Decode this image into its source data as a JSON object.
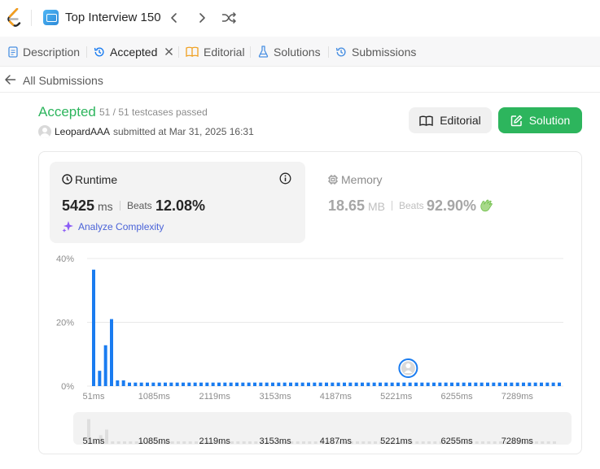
{
  "topbar": {
    "study_title": "Top Interview 150",
    "icons": [
      "leetcode-logo",
      "study-plan-icon",
      "chevron-left-icon",
      "chevron-right-icon",
      "shuffle-icon"
    ]
  },
  "tabs": [
    {
      "label": "Description",
      "icon": "description-icon"
    },
    {
      "label": "Accepted",
      "icon": "history-icon"
    },
    {
      "label": "Editorial",
      "icon": "book-icon"
    },
    {
      "label": "Solutions",
      "icon": "flask-icon"
    },
    {
      "label": "Submissions",
      "icon": "history-icon"
    }
  ],
  "back": {
    "label": "All Submissions"
  },
  "result": {
    "status": "Accepted",
    "testcases": "51 / 51 testcases passed",
    "username": "LeopardAAA",
    "submitted": "submitted at Mar 31, 2025 16:31"
  },
  "buttons": {
    "editorial": "Editorial",
    "solution": "Solution"
  },
  "runtime": {
    "title": "Runtime",
    "value": "5425",
    "unit": "ms",
    "beats_label": "Beats",
    "beats": "12.08%",
    "analyze": "Analyze Complexity"
  },
  "memory": {
    "title": "Memory",
    "value": "18.65",
    "unit": "MB",
    "beats_label": "Beats",
    "beats": "92.90%"
  },
  "colors": {
    "accent_green": "#2db55d",
    "bar_blue": "#1a7cf0",
    "link_purple": "#4a63d8"
  },
  "chart_data": {
    "type": "bar",
    "xlabel": "",
    "ylabel": "",
    "yticks": [
      "0%",
      "20%",
      "40%"
    ],
    "ylim": [
      0,
      40
    ],
    "xticks": [
      "51ms",
      "1085ms",
      "2119ms",
      "3153ms",
      "4187ms",
      "5221ms",
      "6255ms",
      "7289ms"
    ],
    "x_unit": "ms",
    "x_start_ms": 51,
    "x_bin_ms": 102,
    "values": [
      36.5,
      4.8,
      12.8,
      21.0,
      1.8,
      1.8,
      1.1,
      1.1,
      1.1,
      1.1,
      1.1,
      1.1,
      1.1,
      1.1,
      1.1,
      1.1,
      1.1,
      1.1,
      1.1,
      1.1,
      1.1,
      1.1,
      1.1,
      1.1,
      1.1,
      1.1,
      1.1,
      1.1,
      1.1,
      1.1,
      1.1,
      1.1,
      1.1,
      1.1,
      1.1,
      1.1,
      1.1,
      1.1,
      1.1,
      1.1,
      1.1,
      1.1,
      1.1,
      1.1,
      1.1,
      1.1,
      1.1,
      1.1,
      1.1,
      1.1,
      1.1,
      1.1,
      1.1,
      1.1,
      1.1,
      1.1,
      1.1,
      1.1,
      1.1,
      1.1,
      1.1,
      1.1,
      1.1,
      1.1,
      1.1,
      1.1,
      1.1,
      1.1,
      1.1,
      1.1,
      1.1,
      1.1,
      1.1,
      1.1,
      1.1,
      1.1,
      1.1,
      1.1,
      1.1
    ],
    "user_marker_ms": 5425,
    "grid": true
  }
}
